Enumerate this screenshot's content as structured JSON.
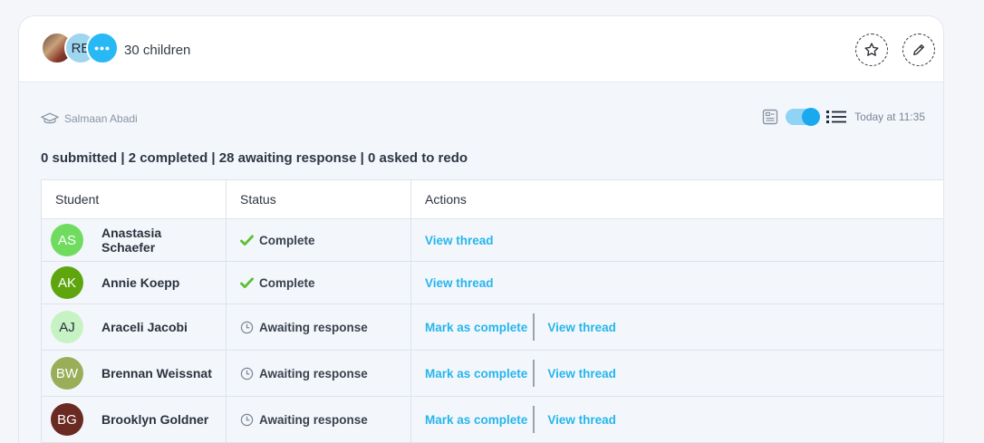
{
  "header": {
    "avatar_initials": "RE",
    "more_label": "•••",
    "children_count": "30 children",
    "star_icon": "star-icon",
    "edit_icon": "pencil-icon"
  },
  "meta": {
    "teacher_name": "Salmaan Abadi",
    "teacher_icon": "graduation-cap-icon",
    "card_view_icon": "card-view-icon",
    "list_view_icon": "list-view-icon",
    "timestamp": "Today at 11:35"
  },
  "summary": "0 submitted | 2 completed | 28 awaiting response | 0 asked to redo",
  "table": {
    "headers": [
      "Student",
      "Status",
      "Actions"
    ],
    "rows": [
      {
        "initials": "AS",
        "name": "Anastasia Schaefer",
        "avatar_bg": "#6fdc5f",
        "avatar_fg": "#ffffff",
        "status": "Complete",
        "status_icon": "check-icon",
        "mark_complete": "",
        "view_thread": "View thread"
      },
      {
        "initials": "AK",
        "name": "Annie Koepp",
        "avatar_bg": "#5ea50e",
        "avatar_fg": "#ffffff",
        "status": "Complete",
        "status_icon": "check-icon",
        "mark_complete": "",
        "view_thread": "View thread"
      },
      {
        "initials": "AJ",
        "name": "Araceli Jacobi",
        "avatar_bg": "#c7f3c4",
        "avatar_fg": "#2a3040",
        "status": "Awaiting response",
        "status_icon": "clock-icon",
        "mark_complete": "Mark as complete",
        "view_thread": "View thread"
      },
      {
        "initials": "BW",
        "name": "Brennan Weissnat",
        "avatar_bg": "#9aae5a",
        "avatar_fg": "#ffffff",
        "status": "Awaiting response",
        "status_icon": "clock-icon",
        "mark_complete": "Mark as complete",
        "view_thread": "View thread"
      },
      {
        "initials": "BG",
        "name": "Brooklyn Goldner",
        "avatar_bg": "#6a2a22",
        "avatar_fg": "#ffffff",
        "status": "Awaiting response",
        "status_icon": "clock-icon",
        "mark_complete": "Mark as complete",
        "view_thread": "View thread"
      }
    ]
  },
  "colors": {
    "accent": "#27b5eb",
    "complete": "#5bbf33"
  }
}
